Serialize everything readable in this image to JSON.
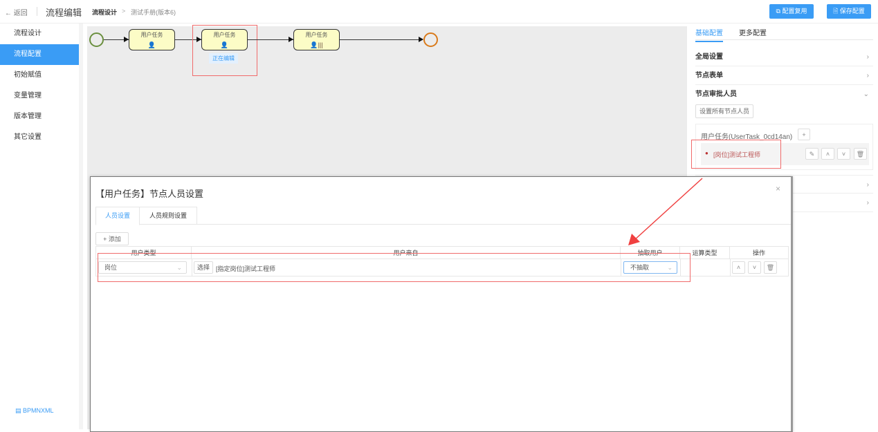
{
  "header": {
    "back_label": "返回",
    "app_title": "流程编辑",
    "breadcrumb": [
      "流程设计",
      "测试手册(版本6)"
    ],
    "copy_config": "配置复用",
    "save_config": "保存配置"
  },
  "sidebar": {
    "items": [
      {
        "label": "流程设计"
      },
      {
        "label": "流程配置"
      },
      {
        "label": "初始赋值"
      },
      {
        "label": "变量管理"
      },
      {
        "label": "版本管理"
      },
      {
        "label": "其它设置"
      }
    ],
    "active": "流程配置",
    "bpmn_link": "BPMNXML"
  },
  "diagram": {
    "nodes": [
      {
        "label": "用户任务"
      },
      {
        "label": "用户任务"
      },
      {
        "label": "用户任务"
      }
    ],
    "editing_badge": "正在编辑"
  },
  "right_panel": {
    "tabs": [
      "基础配置",
      "更多配置"
    ],
    "sections": [
      "全局设置",
      "节点表单",
      "节点审批人员"
    ],
    "set_all_button": "设置所有节点人员",
    "task_label": "用户任务(UserTask_0cd14an)",
    "assignee": "[岗位]测试工程师"
  },
  "modal": {
    "title": "【用户任务】节点人员设置",
    "tabs": [
      "人员设置",
      "人员规则设置"
    ],
    "add_button": "添加",
    "columns": [
      "用户类型",
      "用户来自",
      "抽取用户",
      "运算类型",
      "操作"
    ],
    "row": {
      "user_type": "岗位",
      "select_button": "选择",
      "user_from": "[指定岗位]测试工程师",
      "extract": "不抽取"
    }
  },
  "colors": {
    "accent": "#3a9cf5",
    "highlight": "#f06a6a"
  }
}
